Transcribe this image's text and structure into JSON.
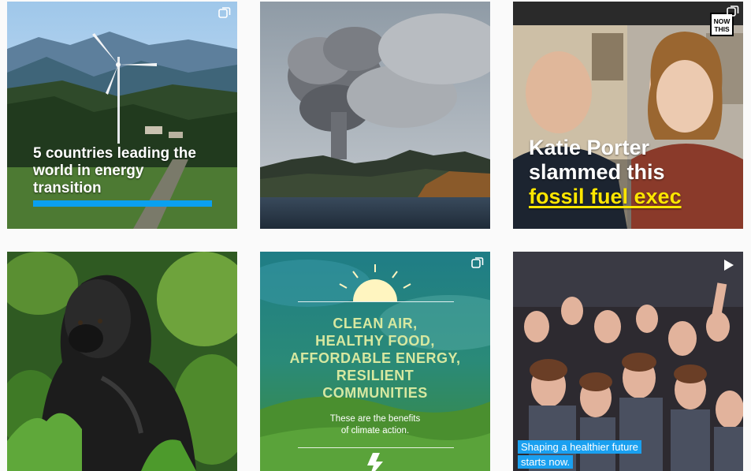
{
  "posts": [
    {
      "caption_lines": [
        "5 countries leading the",
        "world in energy",
        "transition"
      ],
      "icon": "carousel-icon",
      "accent": "#0aa0f0"
    },
    {
      "icon": "none"
    },
    {
      "brand_logo": [
        "NOW",
        "THIS"
      ],
      "headline": [
        "Katie Porter",
        "slammed this"
      ],
      "headline_highlight": "fossil fuel exec",
      "highlight_color": "#ffe600",
      "icon": "carousel-icon"
    },
    {
      "icon": "none"
    },
    {
      "big_lines": [
        "CLEAN AIR,",
        "HEALTHY FOOD,",
        "AFFORDABLE ENERGY,",
        "RESILIENT",
        "COMMUNITIES"
      ],
      "small_lines": [
        "These are the benefits",
        "of climate action."
      ],
      "icon": "carousel-icon"
    },
    {
      "subtitle_lines": [
        "Shaping a healthier future",
        "starts now."
      ],
      "icon": "video-icon",
      "accent": "#1aa0f0"
    }
  ]
}
